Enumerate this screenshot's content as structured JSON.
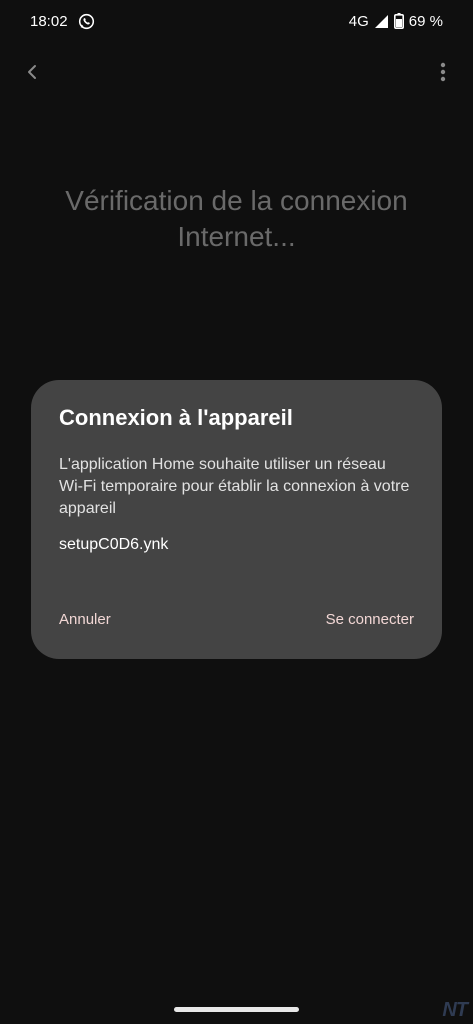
{
  "status_bar": {
    "time": "18:02",
    "network": "4G",
    "battery": "69 %",
    "icons": [
      "whatsapp-icon",
      "signal-icon",
      "battery-icon"
    ]
  },
  "app_bar": {
    "icons": [
      "back-arrow-icon",
      "more-vert-icon"
    ]
  },
  "page": {
    "title": "Vérification de la connexion Internet..."
  },
  "dialog": {
    "title": "Connexion à l'appareil",
    "body": "L'application Home souhaite utiliser un réseau Wi-Fi temporaire pour établir la connexion à votre appareil",
    "network_name": "setupC0D6.ynk",
    "cancel_label": "Annuler",
    "confirm_label": "Se connecter"
  },
  "watermark": {
    "text": "NT"
  },
  "colors": {
    "background": "#0f0f0f",
    "dialog_bg": "#444444",
    "accent_text": "#f2d7d5",
    "dim_title": "#6a6a6a"
  }
}
